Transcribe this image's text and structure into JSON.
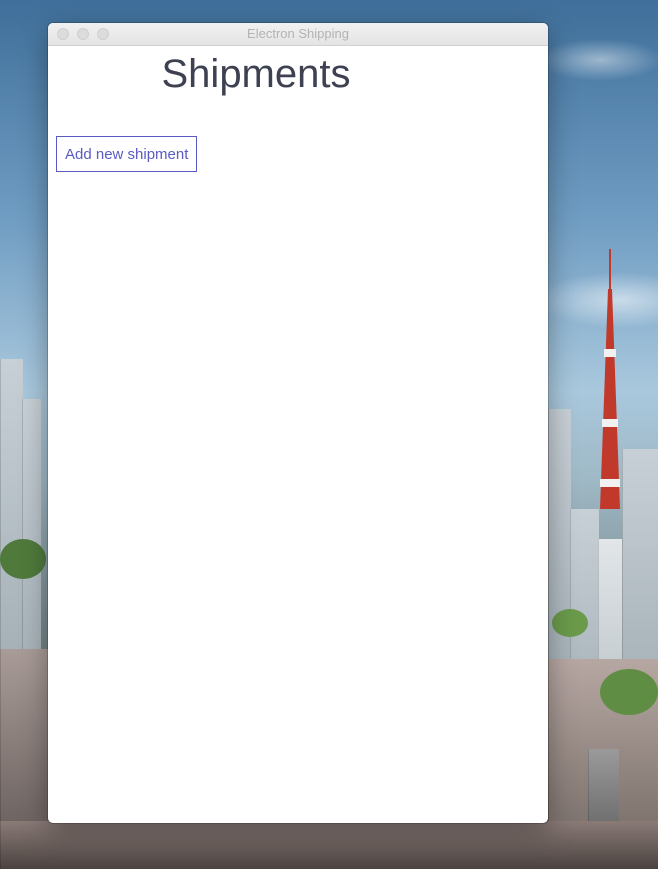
{
  "window": {
    "title": "Electron Shipping"
  },
  "page": {
    "title": "Shipments"
  },
  "actions": {
    "add_shipment_label": "Add new shipment"
  },
  "colors": {
    "title_text": "#3d4152",
    "button_accent": "#5a5bc4",
    "window_title_text": "#b3b3b3"
  }
}
